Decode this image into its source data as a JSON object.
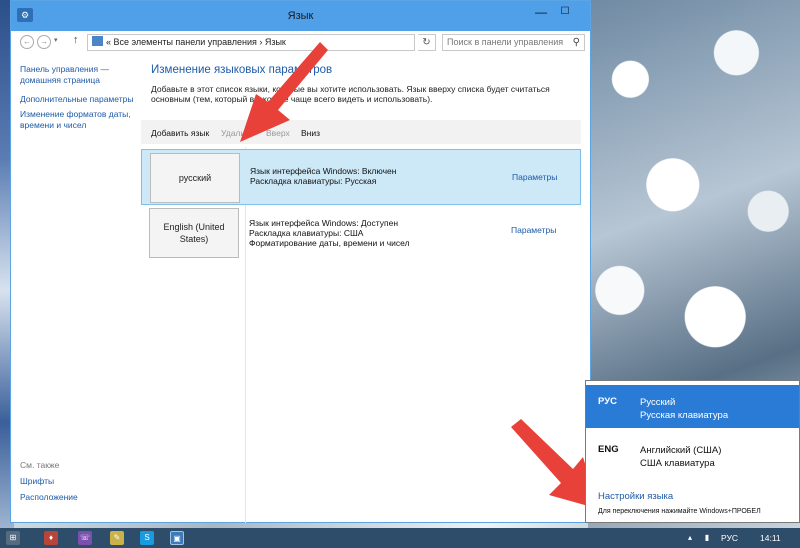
{
  "window": {
    "title": "Язык",
    "min_glyph": "—",
    "max_glyph": "☐"
  },
  "address": {
    "path": "«  Все элементы панели управления  ›  Язык",
    "search_placeholder": "Поиск в панели управления"
  },
  "sidebar": {
    "home": "Панель управления — домашняя страница",
    "items": [
      "Дополнительные параметры",
      "Изменение форматов даты, времени и чисел"
    ]
  },
  "see_also": {
    "header": "См. также",
    "items": [
      "Шрифты",
      "Расположение"
    ]
  },
  "main": {
    "heading": "Изменение языковых параметров",
    "description": "Добавьте в этот список языки, которые вы хотите использовать. Язык вверху списка будет считаться основным (тем, который вы хотите чаще всего видеть и использовать)."
  },
  "toolbar": {
    "add": "Добавить язык",
    "remove": "Удалить",
    "up": "Вверх",
    "down": "Вниз"
  },
  "languages": [
    {
      "name": "русский",
      "lines": [
        "Язык интерфейса Windows: Включен",
        "Раскладка клавиатуры: Русская"
      ],
      "params": "Параметры"
    },
    {
      "name": "English (United States)",
      "lines": [
        "Язык интерфейса Windows: Доступен",
        "Раскладка клавиатуры: США",
        "Форматирование даты, времени и чисел"
      ],
      "params": "Параметры"
    }
  ],
  "flyout": {
    "items": [
      {
        "code": "РУС",
        "line1": "Русский",
        "line2": "Русская клавиатура"
      },
      {
        "code": "ENG",
        "line1": "Английский (США)",
        "line2": "США клавиатура"
      }
    ],
    "settings": "Настройки языка",
    "hint": "Для переключения нажимайте Windows+ПРОБЕЛ"
  },
  "tray": {
    "lang": "РУС",
    "time": "14:11"
  },
  "colors": {
    "accent": "#4fa0e8",
    "link": "#1e5aa8",
    "flyout_active": "#2a7bd5",
    "arrow": "#e8413a"
  }
}
